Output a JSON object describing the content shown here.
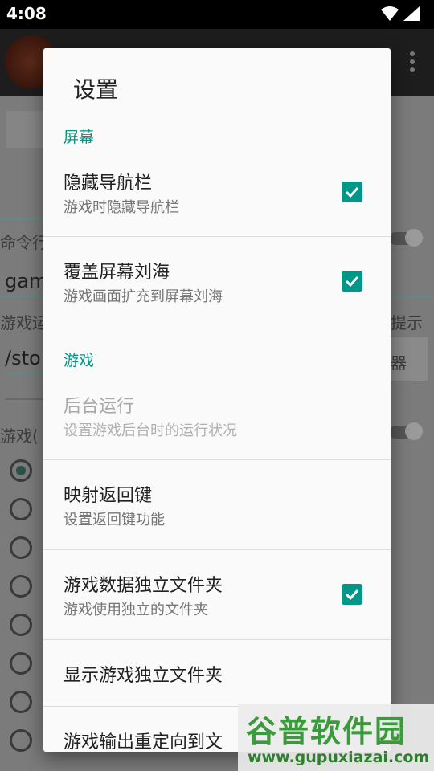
{
  "status_bar": {
    "time": "4:08"
  },
  "background": {
    "labels": [
      "命令行",
      "gam",
      "游戏运",
      "提示",
      "/sto",
      "器",
      "游戏("
    ]
  },
  "dialog": {
    "title": "设置",
    "categories": [
      {
        "title": "屏幕"
      },
      {
        "title": "游戏"
      }
    ],
    "items": [
      {
        "title": "隐藏导航栏",
        "summary": "游戏时隐藏导航栏",
        "checked": true,
        "enabled": true
      },
      {
        "title": "覆盖屏幕刘海",
        "summary": "游戏画面扩充到屏幕刘海",
        "checked": true,
        "enabled": true
      },
      {
        "title": "后台运行",
        "summary": "设置游戏后台时的运行状况",
        "enabled": false
      },
      {
        "title": "映射返回键",
        "summary": "设置返回键功能",
        "enabled": true
      },
      {
        "title": "游戏数据独立文件夹",
        "summary": "游戏使用独立的文件夹",
        "checked": true,
        "enabled": true
      },
      {
        "title": "显示游戏独立文件夹",
        "enabled": true
      },
      {
        "title": "游戏输出重定向到文",
        "enabled": true
      }
    ],
    "accent_color": "#009688"
  },
  "watermark": {
    "line1": "谷普软件园",
    "line2": "www.gupuxiazai.com"
  }
}
